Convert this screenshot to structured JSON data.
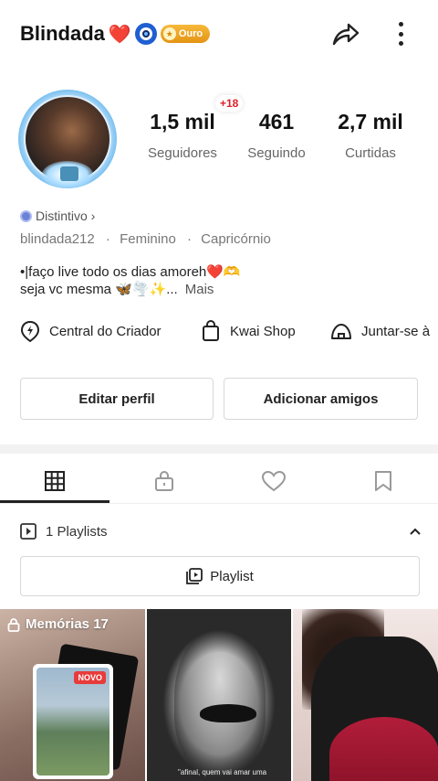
{
  "header": {
    "username": "Blindada",
    "heart": "❤️",
    "level_badge": "Ouro"
  },
  "profile": {
    "plus_badge": "+18",
    "stats": [
      {
        "value": "1,5 mil",
        "label": "Seguidores"
      },
      {
        "value": "461",
        "label": "Seguindo"
      },
      {
        "value": "2,7 mil",
        "label": "Curtidas"
      }
    ],
    "distintivo": "Distintivo ›",
    "handle": "blindada212",
    "gender": "Feminino",
    "sign": "Capricórnio",
    "separator": "·",
    "bio_line1": "•|faço live todo os dias amoreh❤️🫶",
    "bio_line2": "seja vc mesma 🦋🌪️✨...",
    "bio_more": "Mais"
  },
  "links": [
    {
      "icon": "lightning-pin-icon",
      "label": "Central do Criador"
    },
    {
      "icon": "shopping-bag-icon",
      "label": "Kwai Shop"
    },
    {
      "icon": "group-tent-icon",
      "label": "Juntar-se à"
    }
  ],
  "actions": {
    "edit_label": "Editar perfil",
    "add_friends_label": "Adicionar amigos"
  },
  "tabs": [
    "grid-icon",
    "lock-icon",
    "heart-icon",
    "bookmark-icon"
  ],
  "playlists": {
    "count_label": "1 Playlists",
    "button_label": "Playlist"
  },
  "grid": {
    "cell1_title": "Memórias 17",
    "cell1_badge": "NOVO",
    "cell2_caption": "\"afinal, quem vai amar uma"
  },
  "colors": {
    "accent_red": "#e0202a",
    "ouro_badge": "#f0a828",
    "text": "#222222",
    "muted": "#777777"
  }
}
